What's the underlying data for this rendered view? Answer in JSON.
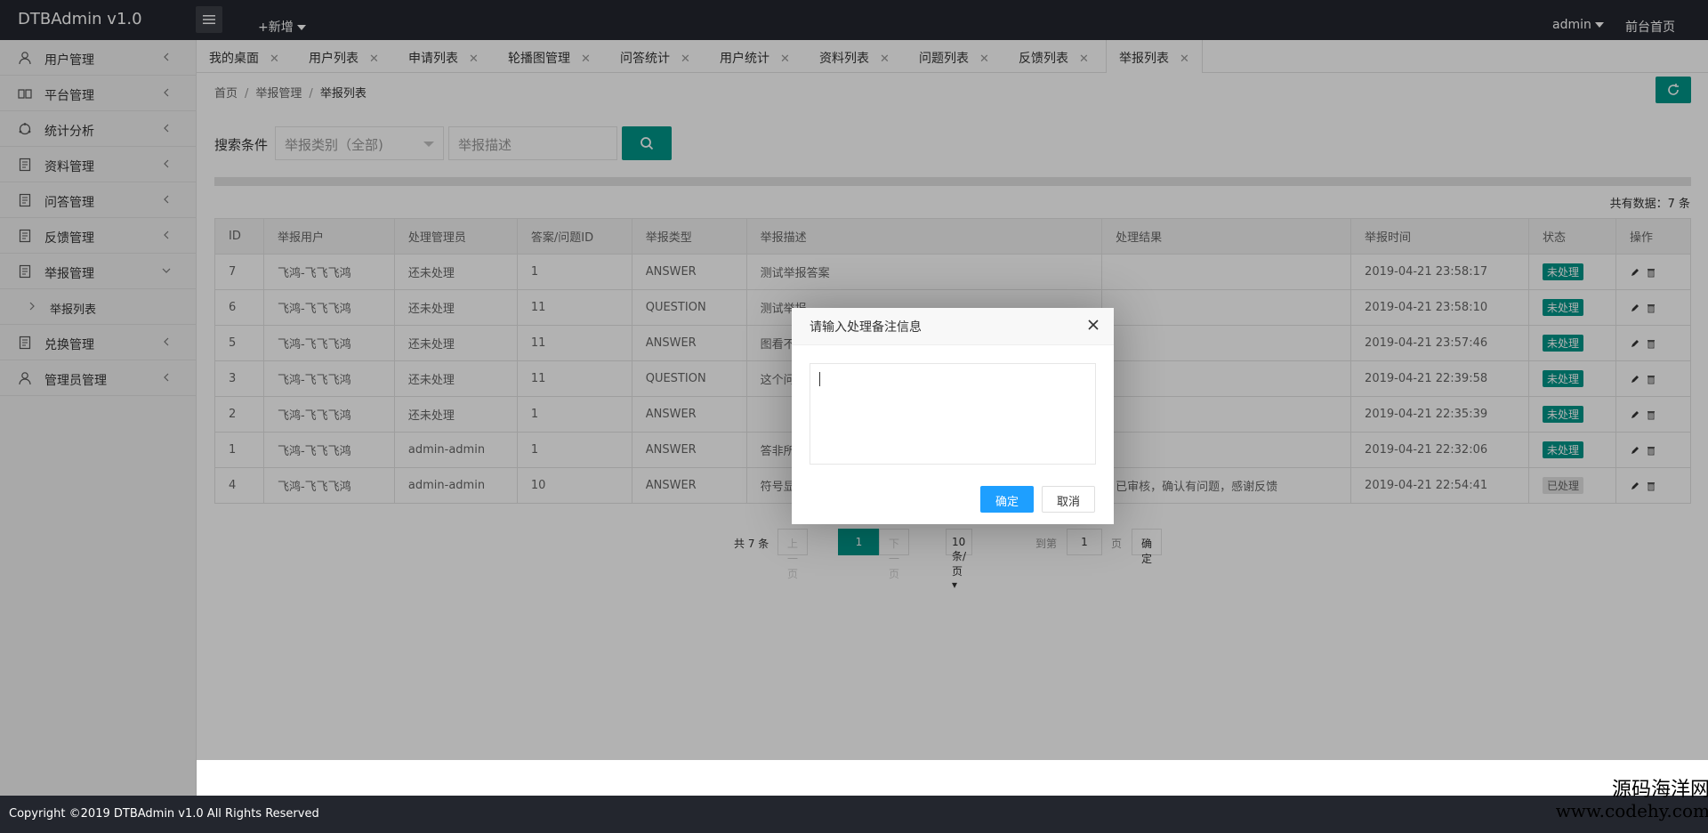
{
  "topbar": {
    "title": "DTBAdmin v1.0",
    "add_new": "+新增",
    "user": "admin",
    "front_home": "前台首页"
  },
  "sidebar": {
    "items": [
      {
        "label": "用户管理",
        "icon": "user-icon"
      },
      {
        "label": "平台管理",
        "icon": "book-icon"
      },
      {
        "label": "统计分析",
        "icon": "chart-icon"
      },
      {
        "label": "资料管理",
        "icon": "doc-icon"
      },
      {
        "label": "问答管理",
        "icon": "doc-icon"
      },
      {
        "label": "反馈管理",
        "icon": "doc-icon"
      },
      {
        "label": "举报管理",
        "icon": "doc-icon",
        "expanded": true
      },
      {
        "label": "兑换管理",
        "icon": "doc-icon"
      },
      {
        "label": "管理员管理",
        "icon": "user-icon"
      }
    ],
    "sub_item": "举报列表"
  },
  "tabs": [
    "我的桌面",
    "用户列表",
    "申请列表",
    "轮播图管理",
    "问答统计",
    "用户统计",
    "资料列表",
    "问题列表",
    "反馈列表",
    "举报列表"
  ],
  "breadcrumb": [
    "首页",
    "举报管理",
    "举报列表"
  ],
  "search": {
    "label": "搜索条件",
    "type_placeholder": "举报类别（全部)",
    "desc_placeholder": "举报描述"
  },
  "total_text": "共有数据：7 条",
  "table": {
    "headers": [
      "ID",
      "举报用户",
      "处理管理员",
      "答案/问题ID",
      "举报类型",
      "举报描述",
      "处理结果",
      "举报时间",
      "状态",
      "操作"
    ],
    "rows": [
      [
        "7",
        "飞鸿-飞飞飞鸿",
        "还未处理",
        "1",
        "ANSWER",
        "测试举报答案",
        "",
        "2019-04-21 23:58:17",
        "未处理"
      ],
      [
        "6",
        "飞鸿-飞飞飞鸿",
        "还未处理",
        "11",
        "QUESTION",
        "测试举报",
        "",
        "2019-04-21 23:58:10",
        "未处理"
      ],
      [
        "5",
        "飞鸿-飞飞飞鸿",
        "还未处理",
        "11",
        "ANSWER",
        "图看不",
        "",
        "2019-04-21 23:57:46",
        "未处理"
      ],
      [
        "3",
        "飞鸿-飞飞飞鸿",
        "还未处理",
        "11",
        "QUESTION",
        "这个问",
        "",
        "2019-04-21 22:39:58",
        "未处理"
      ],
      [
        "2",
        "飞鸿-飞飞飞鸿",
        "还未处理",
        "1",
        "ANSWER",
        "",
        "",
        "2019-04-21 22:35:39",
        "未处理"
      ],
      [
        "1",
        "飞鸿-飞飞飞鸿",
        "admin-admin",
        "1",
        "ANSWER",
        "答非所",
        "",
        "2019-04-21 22:32:06",
        "未处理"
      ],
      [
        "4",
        "飞鸿-飞飞飞鸿",
        "admin-admin",
        "10",
        "ANSWER",
        "符号显",
        "已审核，确认有问题，感谢反馈",
        "2019-04-21 22:54:41",
        "已处理"
      ]
    ]
  },
  "pager": {
    "total": "共 7 条",
    "prev": "上一页",
    "current": "1",
    "next": "下一页",
    "size": "10 条/页",
    "goto": "到第",
    "goto_value": "1",
    "page_unit": "页",
    "confirm": "确定"
  },
  "modal": {
    "title": "请输入处理备注信息",
    "ok": "确定",
    "cancel": "取消"
  },
  "footer": {
    "copyright": "Copyright ©2019 DTBAdmin v1.0 All Rights Reserved"
  },
  "watermark": {
    "line1": "源码海洋网",
    "line2": "www.codehy.com"
  },
  "colors": {
    "accent": "#009688",
    "dark": "#23262e",
    "modal_ok": "#1e9fff"
  }
}
